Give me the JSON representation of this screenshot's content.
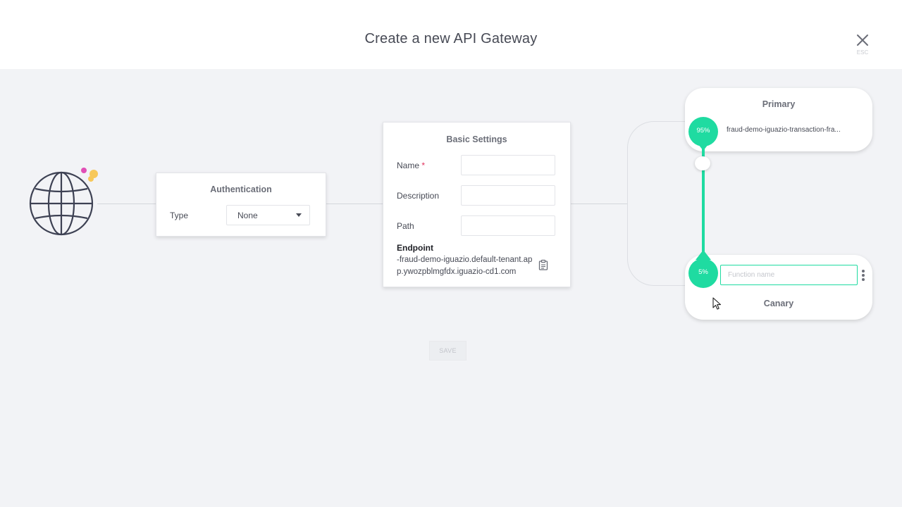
{
  "header": {
    "title": "Create a new API Gateway",
    "close_hint": "ESC"
  },
  "authentication": {
    "title": "Authentication",
    "type_label": "Type",
    "type_value": "None"
  },
  "basic_settings": {
    "title": "Basic Settings",
    "name_label": "Name",
    "required_mark": "*",
    "description_label": "Description",
    "path_label": "Path",
    "endpoint_label": "Endpoint",
    "endpoint_value": "-fraud-demo-iguazio.default-tenant.app.ywozpblmgfdx.iguazio-cd1.com"
  },
  "save_label": "SAVE",
  "primary": {
    "title": "Primary",
    "percent": "95%",
    "function_name": "fraud-demo-iguazio-transaction-fra..."
  },
  "canary": {
    "title": "Canary",
    "percent": "5%",
    "function_placeholder": "Function name"
  },
  "colors": {
    "accent": "#1fdba1",
    "required": "#e1315c",
    "background": "#f2f3f6"
  },
  "icons": [
    "close-icon",
    "globe-icon",
    "copy-icon",
    "kebab-menu-icon",
    "caret-down-icon",
    "mouse-cursor"
  ]
}
